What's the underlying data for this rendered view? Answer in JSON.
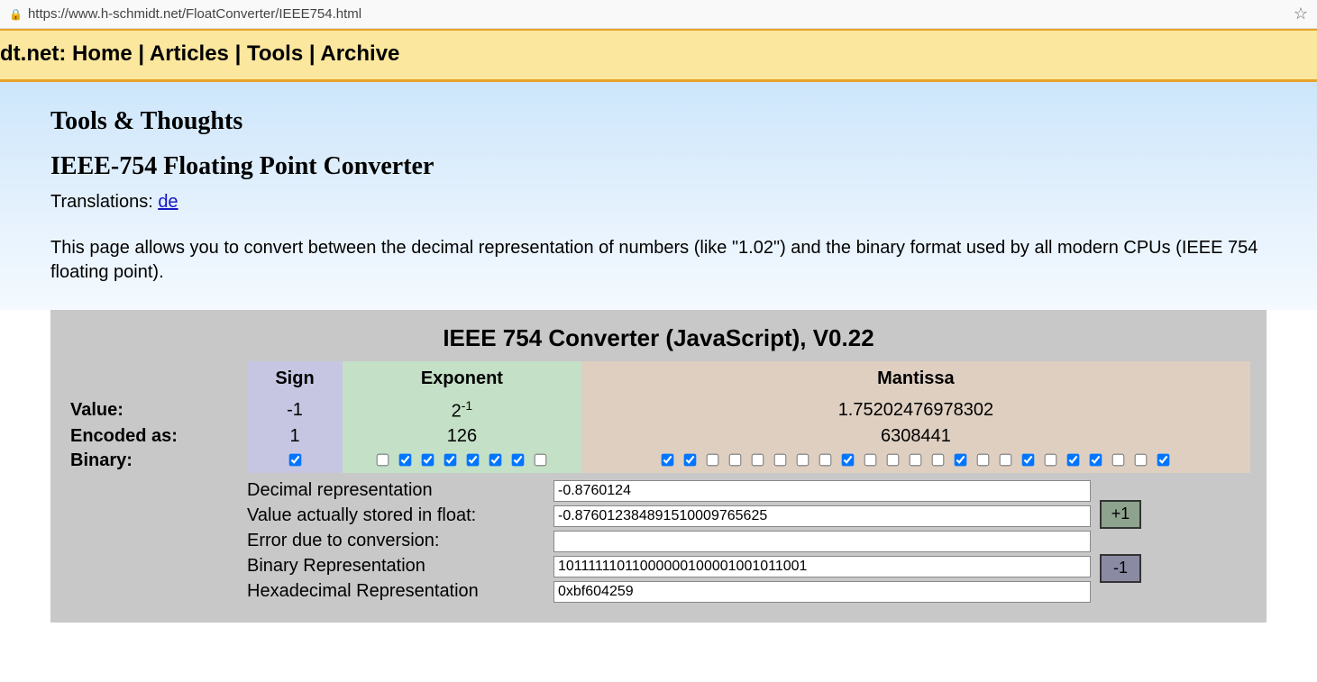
{
  "address": {
    "url": "https://www.h-schmidt.net/FloatConverter/IEEE754.html"
  },
  "topbar": {
    "prefix": "dt.net",
    "links": [
      "Home",
      "Articles",
      "Tools",
      "Archive"
    ]
  },
  "header": {
    "section_title": "Tools & Thoughts",
    "page_title": "IEEE-754 Floating Point Converter",
    "translations_label": "Translations:",
    "translations_link": "de",
    "intro": "This page allows you to convert between the decimal representation of numbers (like \"1.02\") and the binary format used by all modern CPUs (IEEE 754 floating point)."
  },
  "converter": {
    "title": "IEEE 754 Converter (JavaScript), V0.22",
    "col_headers": {
      "sign": "Sign",
      "exponent": "Exponent",
      "mantissa": "Mantissa"
    },
    "rows": {
      "value_label": "Value:",
      "encoded_label": "Encoded as:",
      "binary_label": "Binary:"
    },
    "sign": {
      "value": "-1",
      "encoded": "1",
      "bits": [
        1
      ]
    },
    "exponent": {
      "value_base": "2",
      "value_sup": "-1",
      "encoded": "126",
      "bits": [
        0,
        1,
        1,
        1,
        1,
        1,
        1,
        0
      ]
    },
    "mantissa": {
      "value": "1.75202476978302",
      "encoded": "6308441",
      "bits": [
        1,
        1,
        0,
        0,
        0,
        0,
        0,
        0,
        1,
        0,
        0,
        0,
        0,
        1,
        0,
        0,
        1,
        0,
        1,
        1,
        0,
        0,
        1
      ]
    },
    "fields": {
      "decimal_label": "Decimal representation",
      "decimal_value": "-0.8760124",
      "stored_label": "Value actually stored in float:",
      "stored_value": "-0.87601238489151000976562​5",
      "error_label": "Error due to conversion:",
      "error_value": "",
      "binary_label": "Binary Representation",
      "binary_value": "10111111011000000100001001011001",
      "hex_label": "Hexadecimal Representation",
      "hex_value": "0xbf604259"
    },
    "buttons": {
      "inc": "+1",
      "dec": "-1"
    }
  }
}
